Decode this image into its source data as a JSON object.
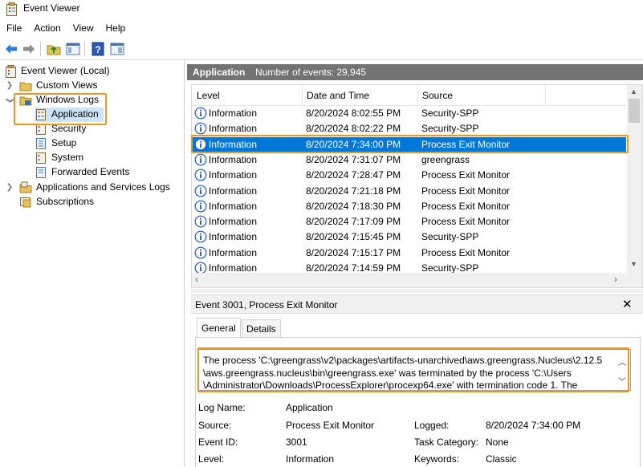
{
  "window": {
    "title": "Event Viewer"
  },
  "menu": [
    "File",
    "Action",
    "View",
    "Help"
  ],
  "toolbar": {
    "buttons": [
      "back-icon",
      "forward-icon",
      "up-folder-icon",
      "show-hide-tree-icon",
      "help-icon",
      "show-hide-action-pane-icon"
    ]
  },
  "tree": {
    "root": "Event Viewer (Local)",
    "custom_views": "Custom Views",
    "windows_logs": "Windows Logs",
    "windows_logs_children": [
      "Application",
      "Security",
      "Setup",
      "System",
      "Forwarded Events"
    ],
    "apps_services": "Applications and Services Logs",
    "subscriptions": "Subscriptions"
  },
  "header": {
    "log_name": "Application",
    "event_count": "Number of events: 29,945"
  },
  "columns": [
    "Level",
    "Date and Time",
    "Source"
  ],
  "events": [
    {
      "level": "Information",
      "date": "8/20/2024 8:02:55 PM",
      "source": "Security-SPP"
    },
    {
      "level": "Information",
      "date": "8/20/2024 8:02:22 PM",
      "source": "Security-SPP"
    },
    {
      "level": "Information",
      "date": "8/20/2024 7:34:00 PM",
      "source": "Process Exit Monitor"
    },
    {
      "level": "Information",
      "date": "8/20/2024 7:31:07 PM",
      "source": "greengrass"
    },
    {
      "level": "Information",
      "date": "8/20/2024 7:28:47 PM",
      "source": "Process Exit Monitor"
    },
    {
      "level": "Information",
      "date": "8/20/2024 7:21:18 PM",
      "source": "Process Exit Monitor"
    },
    {
      "level": "Information",
      "date": "8/20/2024 7:18:30 PM",
      "source": "Process Exit Monitor"
    },
    {
      "level": "Information",
      "date": "8/20/2024 7:17:09 PM",
      "source": "Process Exit Monitor"
    },
    {
      "level": "Information",
      "date": "8/20/2024 7:15:45 PM",
      "source": "Security-SPP"
    },
    {
      "level": "Information",
      "date": "8/20/2024 7:15:17 PM",
      "source": "Process Exit Monitor"
    },
    {
      "level": "Information",
      "date": "8/20/2024 7:14:59 PM",
      "source": "Security-SPP"
    }
  ],
  "detail": {
    "title": "Event 3001, Process Exit Monitor",
    "close": "✕",
    "tabs": [
      "General",
      "Details"
    ],
    "description_lines": [
      "The process 'C:\\greengrass\\v2\\packages\\artifacts-unarchived\\aws.greengrass.Nucleus\\2.12.5",
      "\\aws.greengrass.nucleus\\bin\\greengrass.exe' was terminated by the process 'C:\\Users",
      "\\Administrator\\Downloads\\ProcessExplorer\\procexp64.exe' with termination code 1. The"
    ],
    "fields": {
      "log_name_label": "Log Name:",
      "log_name_value": "Application",
      "source_label": "Source:",
      "source_value": "Process Exit Monitor",
      "logged_label": "Logged:",
      "logged_value": "8/20/2024 7:34:00 PM",
      "event_id_label": "Event ID:",
      "event_id_value": "3001",
      "task_category_label": "Task Category:",
      "task_category_value": "None",
      "level_label": "Level:",
      "level_value": "Information",
      "keywords_label": "Keywords:",
      "keywords_value": "Classic"
    }
  },
  "colors": {
    "highlight": "#f0961e",
    "selection": "#0078d7",
    "header_bg": "#737373",
    "info_icon": "#1e5bb5"
  }
}
